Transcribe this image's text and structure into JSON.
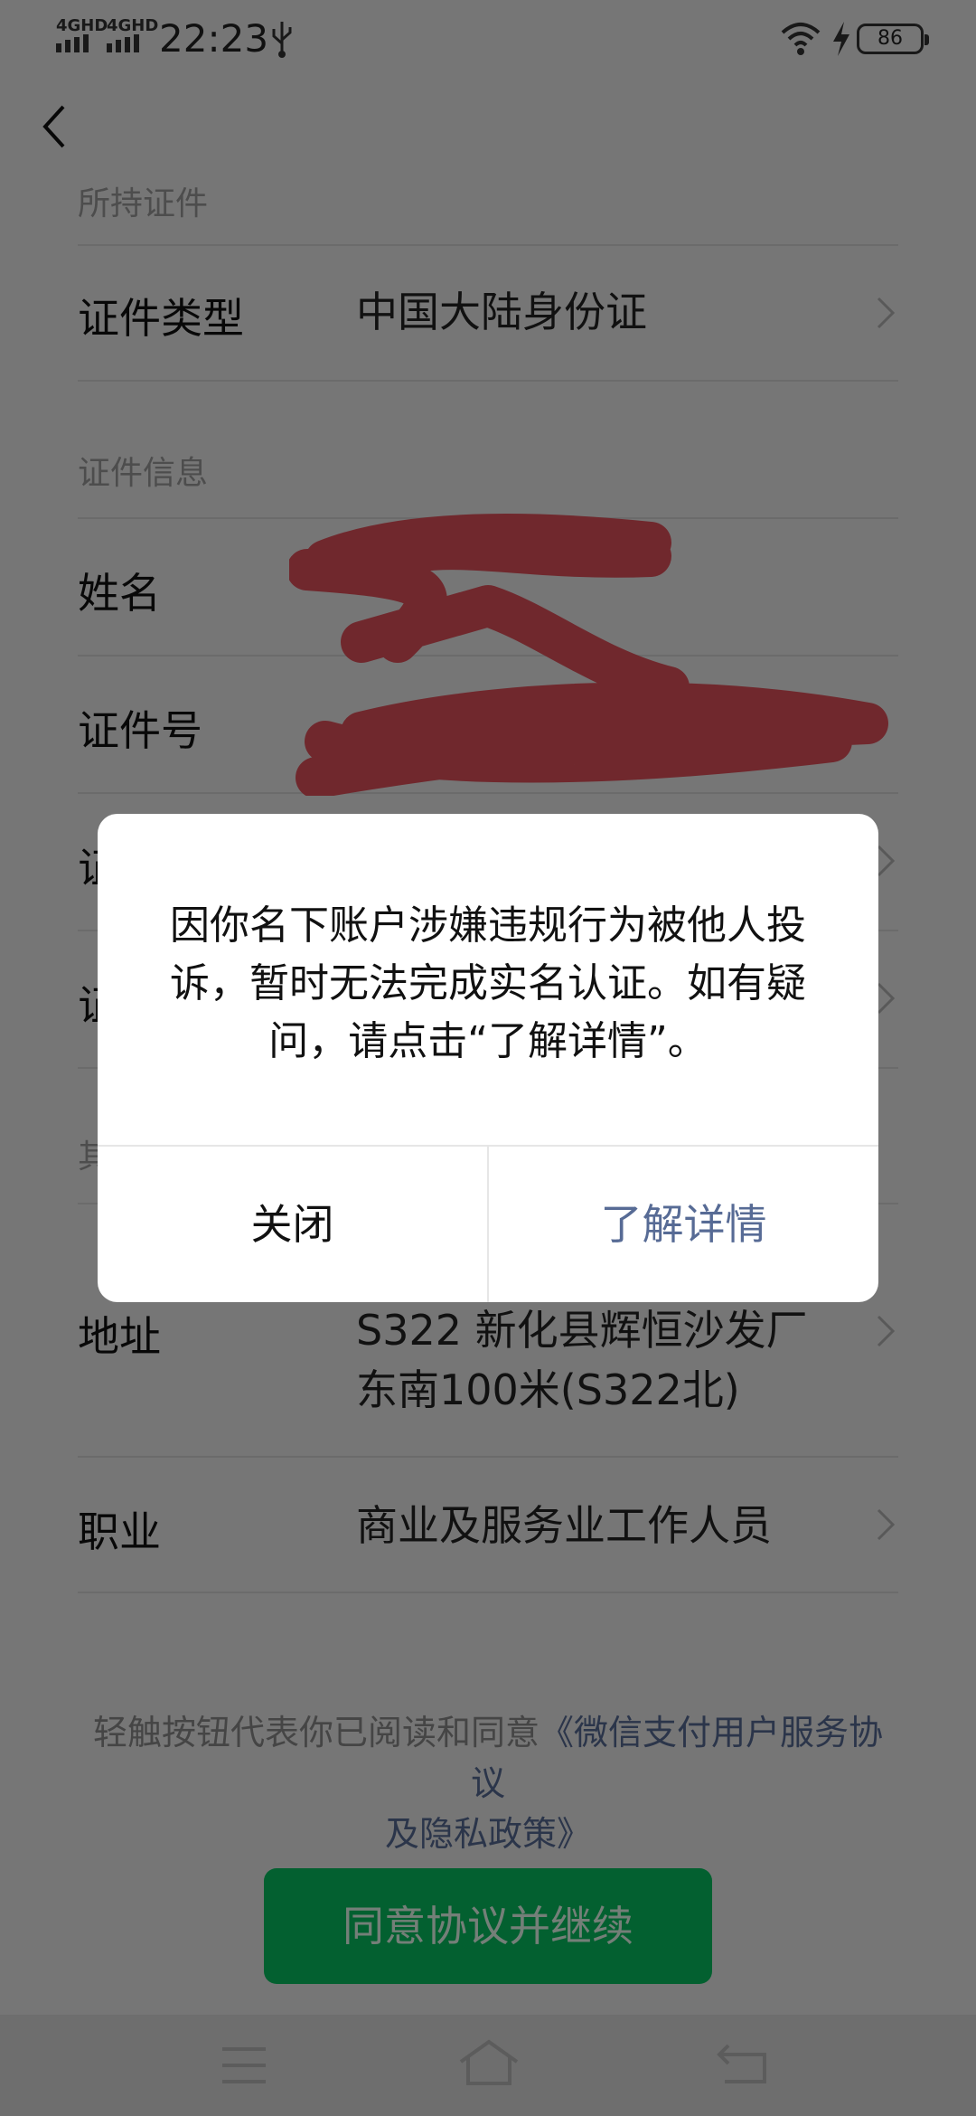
{
  "status_bar": {
    "sim1": "4GHD",
    "sim2": "4GHD",
    "time": "22:23",
    "battery": "86"
  },
  "form": {
    "section_top_partial": "所持证件",
    "id_type": {
      "label": "证件类型",
      "value": "中国大陆身份证"
    },
    "section_info": "证件信息",
    "name": {
      "label": "姓名"
    },
    "id_number": {
      "label": "证件号"
    },
    "row_hidden_1": {
      "label_partial": "证"
    },
    "row_hidden_2": {
      "label_partial": "证"
    },
    "section_other_partial": "其",
    "address": {
      "label": "地址",
      "value_line1": "S322 新化县辉恒沙发厂",
      "value_line2": "东南100米(S322北)"
    },
    "occupation": {
      "label": "职业",
      "value": "商业及服务业工作人员"
    }
  },
  "agreement": {
    "prefix": "轻触按钮代表你已阅读和同意",
    "link_line1": "《微信支付用户服务协议",
    "link_line2": "及隐私政策》"
  },
  "primary_button": {
    "label": "同意协议并继续"
  },
  "dialog": {
    "message_line1": "因你名下账户涉嫌违规行为被他人投",
    "message_line2": "诉，暂时无法完成实名认证。如有疑",
    "message_line3": "问，请点击“了解详情”。",
    "close_label": "关闭",
    "more_label": "了解详情"
  },
  "colors": {
    "accent_green": "#07c160",
    "link_blue": "#576b95",
    "scribble_red": "#e0505a"
  }
}
